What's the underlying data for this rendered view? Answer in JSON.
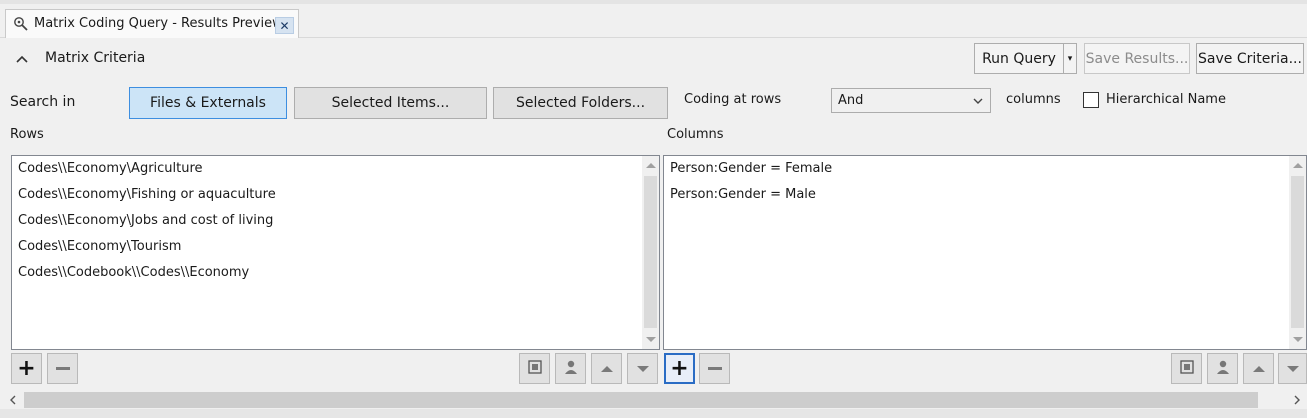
{
  "tab": {
    "title": "Matrix Coding Query - Results Preview",
    "close_label": "✕"
  },
  "header": {
    "title": "Matrix Criteria",
    "run_query": "Run Query",
    "run_query_dropdown": "▾",
    "save_results": "Save Results...",
    "save_criteria": "Save Criteria..."
  },
  "search": {
    "label": "Search in",
    "files_externals": "Files & Externals",
    "selected_items": "Selected Items...",
    "selected_folders": "Selected Folders...",
    "coding_at_rows": "Coding at rows",
    "operator": "And",
    "columns": "columns",
    "hierarchical_name": "Hierarchical Name",
    "hierarchical_checked": false
  },
  "rows": {
    "label": "Rows",
    "items": [
      "Codes\\\\Economy\\Agriculture",
      "Codes\\\\Economy\\Fishing or aquaculture",
      "Codes\\\\Economy\\Jobs and cost of living",
      "Codes\\\\Economy\\Tourism",
      "Codes\\\\Codebook\\\\Codes\\\\Economy"
    ]
  },
  "columns": {
    "label": "Columns",
    "items": [
      "Person:Gender = Female",
      "Person:Gender = Male"
    ]
  },
  "icons": {
    "accent": "#3d8ee0"
  }
}
